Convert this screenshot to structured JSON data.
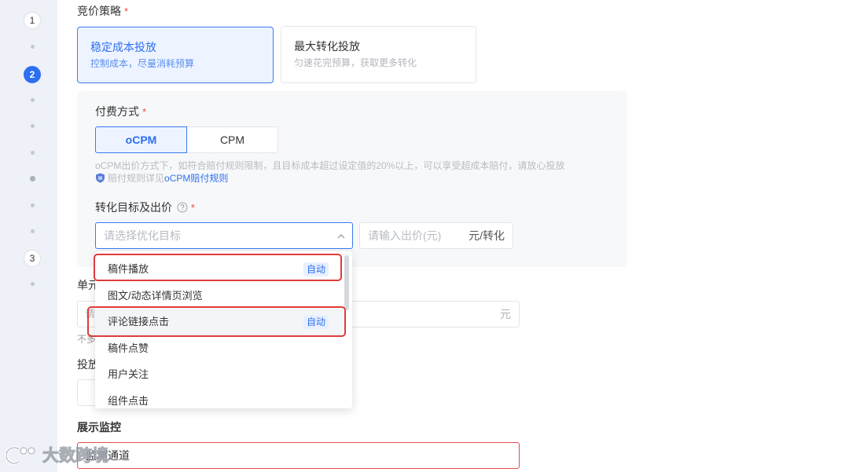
{
  "sidebar": {
    "steps": [
      "1",
      "2",
      "3"
    ],
    "active_step": "2"
  },
  "bid_strategy": {
    "label": "竞价策略",
    "required_mark": "*",
    "options": [
      {
        "title": "稳定成本投放",
        "desc": "控制成本，尽量消耗预算",
        "selected": true
      },
      {
        "title": "最大转化投放",
        "desc": "匀速花完预算，获取更多转化",
        "selected": false
      }
    ]
  },
  "payment": {
    "label": "付费方式",
    "required_mark": "*",
    "options": [
      {
        "label": "oCPM",
        "selected": true
      },
      {
        "label": "CPM",
        "selected": false
      }
    ],
    "note": "oCPM出价方式下，如符合赔付规则限制，且目标成本超过设定值的20%以上，可以享受超成本赔付，请放心投放",
    "rule_prefix": "赔付规则详见",
    "rule_link": "oCPM赔付规则"
  },
  "conversion": {
    "label": "转化目标及出价",
    "required_mark": "*",
    "select_placeholder": "请选择优化目标",
    "bid_placeholder": "请输入出价(元)",
    "bid_suffix": "元/转化"
  },
  "dropdown": {
    "items": [
      {
        "label": "稿件播放",
        "badge": "自动",
        "annotated": true
      },
      {
        "label": "图文/动态详情页浏览"
      },
      {
        "label": "评论链接点击",
        "badge": "自动",
        "annotated": true,
        "hovered": true
      },
      {
        "label": "稿件点赞"
      },
      {
        "label": "用户关注"
      },
      {
        "label": "组件点击"
      }
    ]
  },
  "unit_bid": {
    "label": "单元",
    "placeholder": "请",
    "suffix": "元",
    "hint": "不多"
  },
  "delivery": {
    "label": "投放"
  },
  "monitor": {
    "label": "展示监控",
    "value": "监测通道"
  },
  "watermark": {
    "text": "大数跨境"
  },
  "colors": {
    "accent": "#2d6ff1",
    "required": "#f0494a",
    "error_border": "#e84d4d",
    "annotation": "#e03b3b",
    "panel_bg": "#f7f8fa",
    "sidebar_bg": "#eef1f7"
  }
}
